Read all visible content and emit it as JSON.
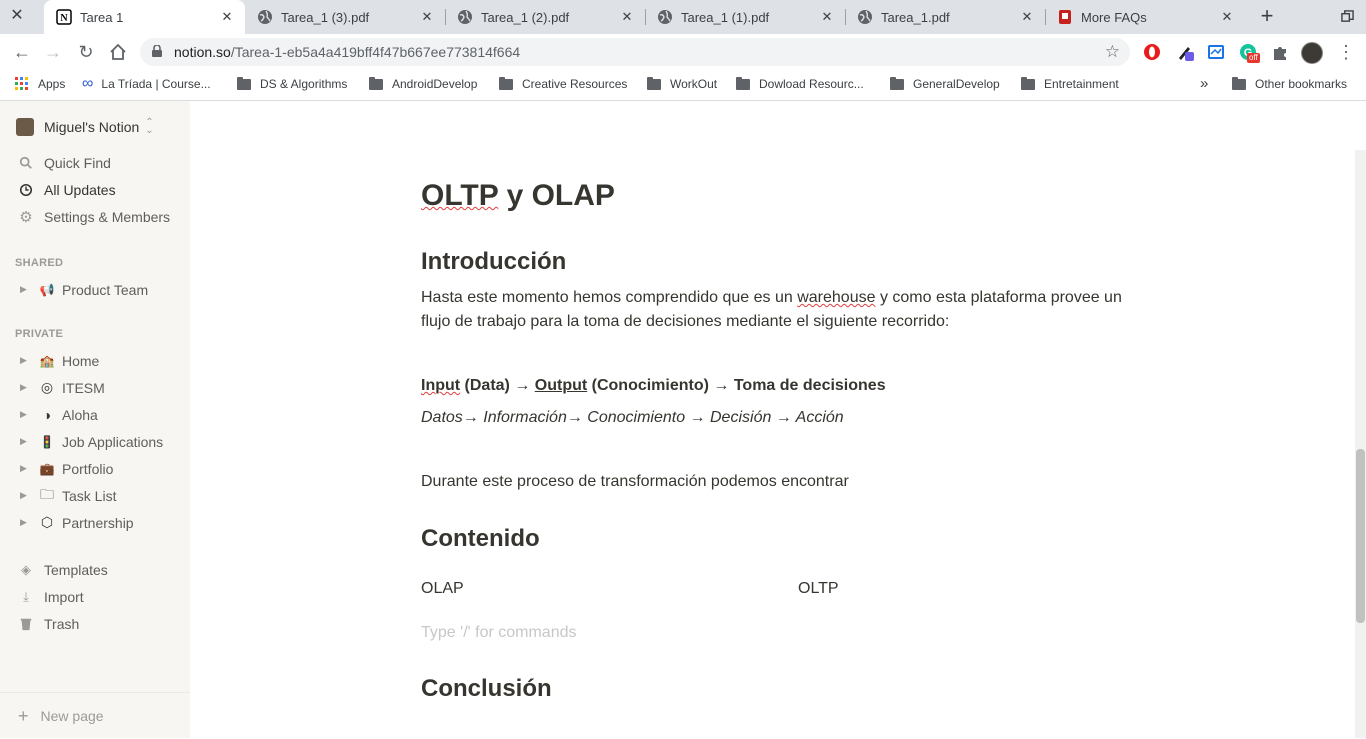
{
  "browser": {
    "tabs": [
      {
        "title": "Tarea 1",
        "active": true,
        "icon": "notion-icon"
      },
      {
        "title": "Tarea_1 (3).pdf",
        "active": false,
        "icon": "globe-icon"
      },
      {
        "title": "Tarea_1 (2).pdf",
        "active": false,
        "icon": "globe-icon"
      },
      {
        "title": "Tarea_1 (1).pdf",
        "active": false,
        "icon": "globe-icon"
      },
      {
        "title": "Tarea_1.pdf",
        "active": false,
        "icon": "globe-icon"
      },
      {
        "title": "More FAQs",
        "active": false,
        "icon": "faq-icon"
      }
    ],
    "url_host": "notion.so",
    "url_path": "/Tarea-1-eb5a4a419bff4f47b667ee773814f664",
    "bookmarks": [
      "Apps",
      "La Tríada | Course...",
      "DS & Algorithms",
      "AndroidDevelop",
      "Creative Resources",
      "WorkOut",
      "Dowload Resourc...",
      "GeneralDevelop",
      "Entretainment"
    ],
    "more_bookmarks": "»",
    "other_bookmarks": "Other bookmarks",
    "ext_badge": "off"
  },
  "sidebar": {
    "workspace": "Miguel's Notion",
    "nav": [
      "Quick Find",
      "All Updates",
      "Settings & Members"
    ],
    "shared_label": "SHARED",
    "shared_pages": [
      {
        "emoji": "📢",
        "label": "Product Team"
      }
    ],
    "private_label": "PRIVATE",
    "private_pages": [
      {
        "emoji": "🏫",
        "label": "Home"
      },
      {
        "emoji": "◎",
        "label": "ITESM"
      },
      {
        "emoji": "◑",
        "label": "Aloha"
      },
      {
        "emoji": "🚦",
        "label": "Job Applications"
      },
      {
        "emoji": "💼",
        "label": "Portfolio"
      },
      {
        "emoji": "🗀",
        "label": "Task List"
      },
      {
        "emoji": "⬡",
        "label": "Partnership"
      }
    ],
    "tools": [
      "Templates",
      "Import",
      "Trash"
    ],
    "new_page": "New page"
  },
  "doc": {
    "title_a": "OLTP",
    "title_b": " y OLAP",
    "intro_heading": "Introducción",
    "intro_p_a": "Hasta este momento hemos comprendido que es un ",
    "intro_p_link": "warehouse",
    "intro_p_b": " y como esta plataforma provee un flujo de trabajo para la toma de decisiones mediante el siguiente recorrido:",
    "flow_input": "Input",
    "flow_mid": " (Data) → ",
    "flow_output": "Output",
    "flow_end": " (Conocimiento) → Toma de decisiones",
    "chain": "Datos→ Información→ Conocimiento → Decisión → Acción",
    "transform": "Durante este proceso de transformación podemos encontrar",
    "content_heading": "Contenido",
    "col_left": "OLAP",
    "col_right": "OLTP",
    "placeholder": "Type '/' for commands",
    "conclusion_heading": "Conclusión"
  }
}
